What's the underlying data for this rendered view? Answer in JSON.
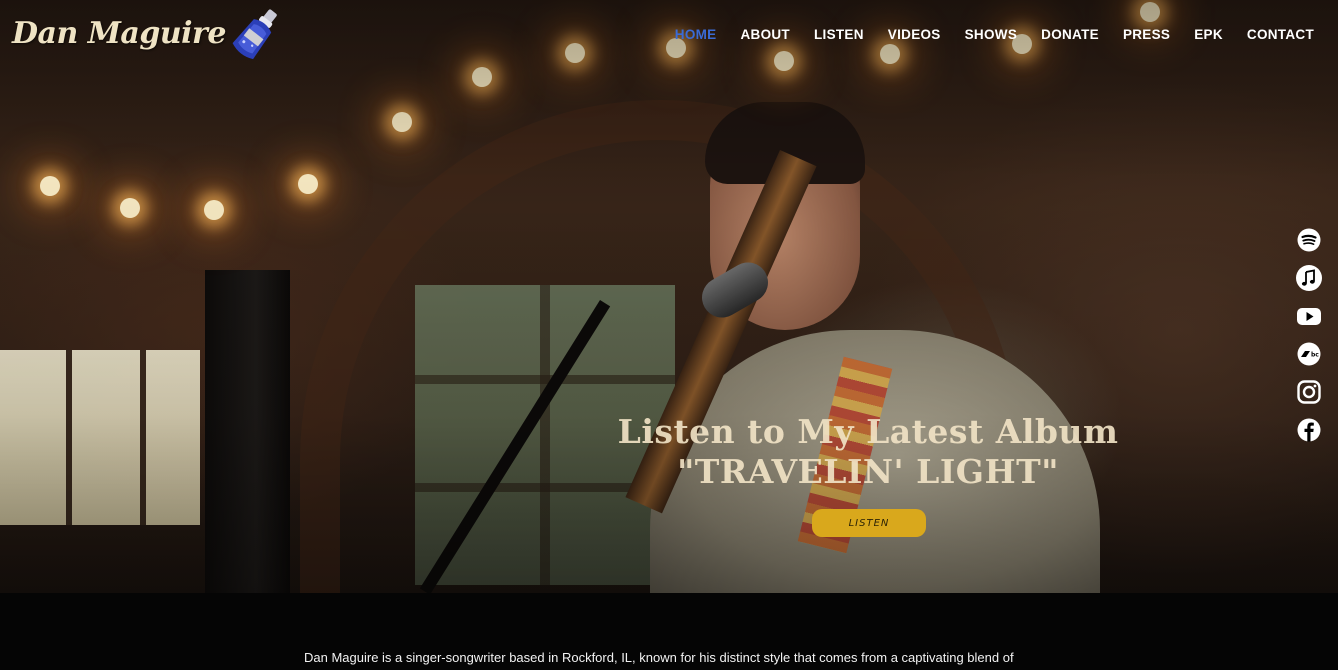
{
  "brand": {
    "name": "Dan Maguire"
  },
  "nav": {
    "items": [
      {
        "label": "HOME",
        "active": true
      },
      {
        "label": "ABOUT",
        "active": false
      },
      {
        "label": "LISTEN",
        "active": false
      },
      {
        "label": "VIDEOS",
        "active": false
      },
      {
        "label": "SHOWS",
        "active": false
      },
      {
        "label": "DONATE",
        "active": false
      },
      {
        "label": "PRESS",
        "active": false
      },
      {
        "label": "EPK",
        "active": false
      },
      {
        "label": "CONTACT",
        "active": false
      }
    ],
    "active_color": "#3a6bd6"
  },
  "social": {
    "icons": [
      "spotify-icon",
      "apple-music-icon",
      "youtube-icon",
      "bandcamp-icon",
      "instagram-icon",
      "facebook-icon"
    ]
  },
  "hero": {
    "title_line1": "Listen to My Latest Album",
    "title_line2": "\"TRAVELIN' LIGHT\"",
    "cta_label": "LISTEN",
    "cta_color": "#d9a81c"
  },
  "bio": {
    "text": "Dan Maguire is a singer-songwriter based in Rockford, IL, known for his distinct style that comes from a captivating blend of"
  }
}
